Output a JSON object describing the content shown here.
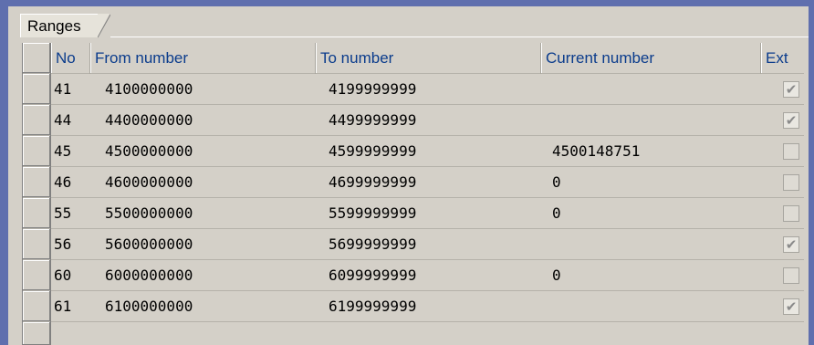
{
  "tab": {
    "label": "Ranges"
  },
  "columns": {
    "no": "No",
    "from": "From number",
    "to": "To number",
    "current": "Current number",
    "ext": "Ext"
  },
  "rows": [
    {
      "no": "41",
      "from": "4100000000",
      "to": "4199999999",
      "current": "",
      "ext": true
    },
    {
      "no": "44",
      "from": "4400000000",
      "to": "4499999999",
      "current": "",
      "ext": true
    },
    {
      "no": "45",
      "from": "4500000000",
      "to": "4599999999",
      "current": "4500148751",
      "ext": false
    },
    {
      "no": "46",
      "from": "4600000000",
      "to": "4699999999",
      "current": "0",
      "ext": false
    },
    {
      "no": "55",
      "from": "5500000000",
      "to": "5599999999",
      "current": "0",
      "ext": false
    },
    {
      "no": "56",
      "from": "5600000000",
      "to": "5699999999",
      "current": "",
      "ext": true
    },
    {
      "no": "60",
      "from": "6000000000",
      "to": "6099999999",
      "current": "0",
      "ext": false
    },
    {
      "no": "61",
      "from": "6100000000",
      "to": "6199999999",
      "current": "",
      "ext": true
    }
  ],
  "icons": {
    "checkmark": "check-icon"
  },
  "colors": {
    "header_text": "#0b3c8c",
    "frame": "#5f6fae",
    "background": "#d4d0c8"
  }
}
